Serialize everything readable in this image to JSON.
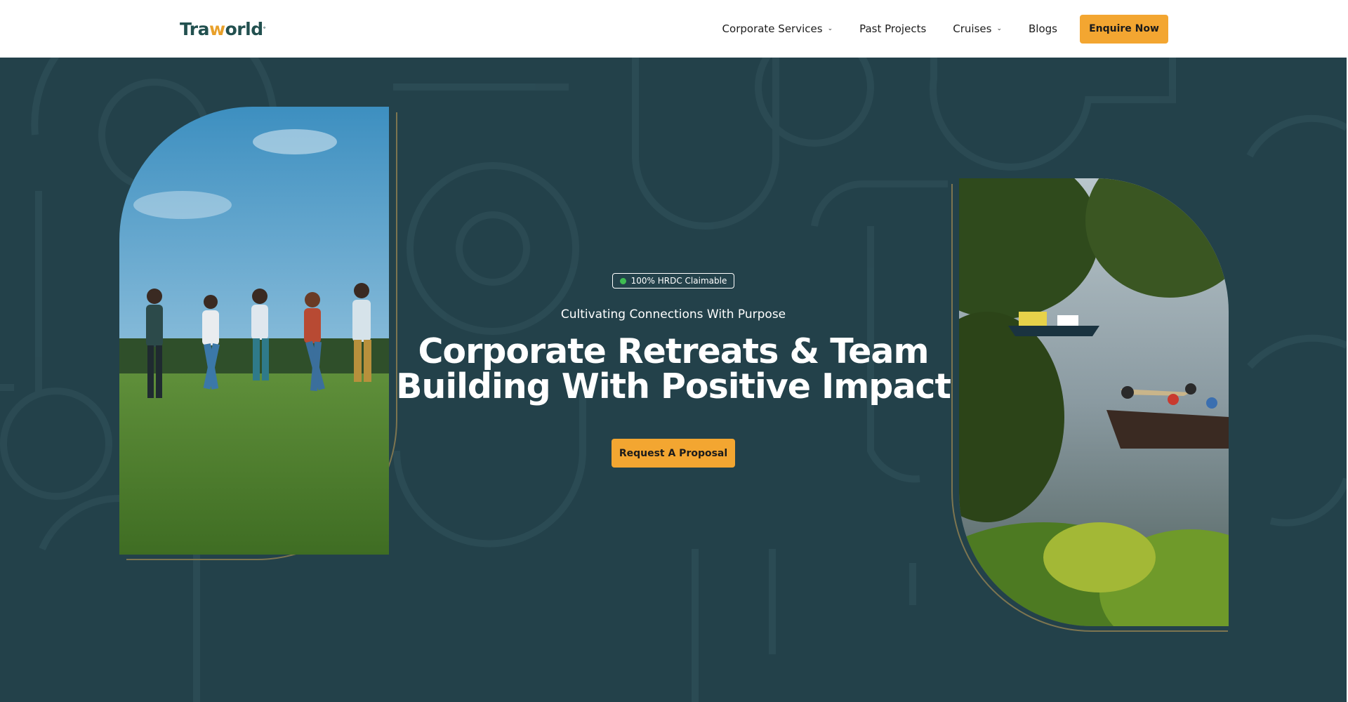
{
  "brand": {
    "logo_text_a": "Tra",
    "logo_text_b": "w",
    "logo_text_c": "orld",
    "logo_mark": "°",
    "colors": {
      "accent": "#f3a631",
      "hero_bg": "#23414a",
      "logo_teal": "#22504f",
      "badge_dot": "#3fbd52"
    }
  },
  "nav": {
    "items": [
      {
        "label": "Corporate Services",
        "dropdown": true
      },
      {
        "label": "Past Projects",
        "dropdown": false
      },
      {
        "label": "Cruises",
        "dropdown": true
      },
      {
        "label": "Blogs",
        "dropdown": false
      }
    ],
    "cta_label": "Enquire Now",
    "chevron_icon": "chevron-down-icon"
  },
  "hero": {
    "badge_text": "100% HRDC Claimable",
    "tagline": "Cultivating Connections With Purpose",
    "headline_line1": "Corporate Retreats & Team",
    "headline_line2": "Building With Positive Impact",
    "cta_label": "Request A Proposal",
    "left_image": "people-jumping-on-grass-photo",
    "right_image": "boats-on-lake-through-trees-photo"
  }
}
